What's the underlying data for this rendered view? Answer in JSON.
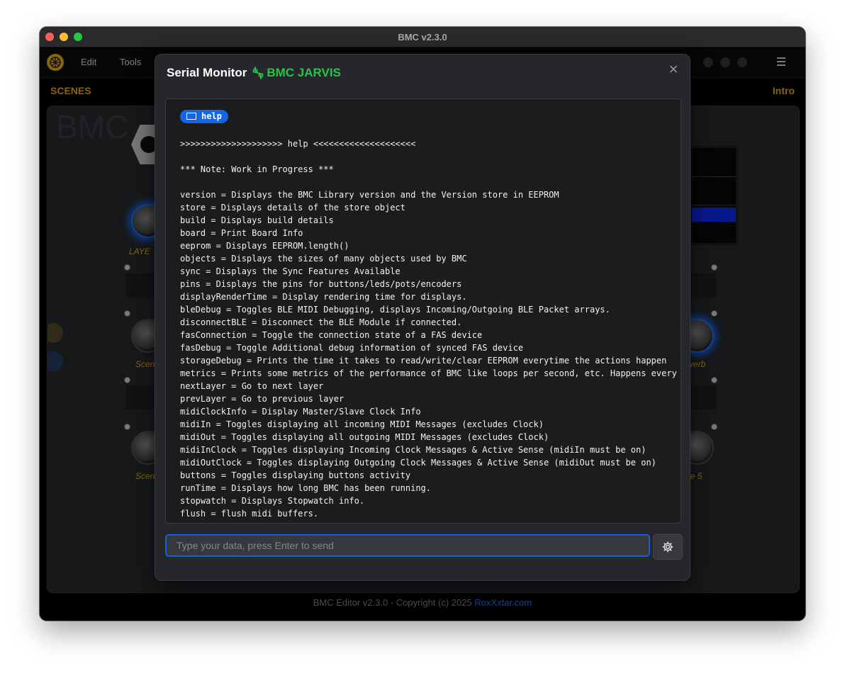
{
  "window": {
    "title": "BMC v2.3.0"
  },
  "menu": {
    "edit": "Edit",
    "tools": "Tools"
  },
  "subbar": {
    "left": "SCENES",
    "right": "Intro"
  },
  "board": {
    "title": "BMC",
    "labels": [
      "LAYE",
      "Scen",
      "Scen",
      "verb",
      "ne 5"
    ]
  },
  "footer": {
    "text": "BMC Editor v2.3.0 - Copyright (c) 2025 ",
    "link": "RoxXxtar.com"
  },
  "modal": {
    "title": "Serial Monitor",
    "device": "BMC JARVIS",
    "badge": "help",
    "lines": [
      ">>>>>>>>>>>>>>>>>>>> help <<<<<<<<<<<<<<<<<<<<",
      "",
      "*** Note: Work in Progress ***",
      "",
      "version = Displays the BMC Library version and the Version store in EEPROM",
      "store = Displays details of the store object",
      "build = Displays build details",
      "board = Print Board Info",
      "eeprom = Displays EEPROM.length()",
      "objects = Displays the sizes of many objects used by BMC",
      "sync = Displays the Sync Features Available",
      "pins = Displays the pins for buttons/leds/pots/encoders",
      "displayRenderTime = Display rendering time for displays.",
      "bleDebug = Toggles BLE MIDI Debugging, displays Incoming/Outgoing BLE Packet arrays.",
      "disconnectBLE = Disconnect the BLE Module if connected.",
      "fasConnection = Toggle the connection state of a FAS device",
      "fasDebug = Toggle Additional debug information of synced FAS device",
      "storageDebug = Prints the time it takes to read/write/clear EEPROM everytime the actions happen",
      "metrics = Prints some metrics of the performance of BMC like loops per second, etc. Happens every",
      "nextLayer = Go to next layer",
      "prevLayer = Go to previous layer",
      "midiClockInfo = Display Master/Slave Clock Info",
      "midiIn = Toggles displaying all incoming MIDI Messages (excludes Clock)",
      "midiOut = Toggles displaying all outgoing MIDI Messages (excludes Clock)",
      "midiInClock = Toggles displaying Incoming Clock Messages & Active Sense (midiIn must be on)",
      "midiOutClock = Toggles displaying Outgoing Clock Messages & Active Sense (midiOut must be on)",
      "buttons = Toggles displaying buttons activity",
      "runTime = Displays how long BMC has been running.",
      "stopwatch = Displays Stopwatch info.",
      "flush = flush midi buffers."
    ],
    "input_placeholder": "Type your data, press Enter to send",
    "input_value": ""
  },
  "colors": {
    "accent": "#f5b81c",
    "jarvis": "#27c34a",
    "badge": "#1565e6",
    "link": "#2f80ff"
  },
  "icons": [
    "logo-icon",
    "hamburger-icon",
    "close-icon",
    "usb-plug-icon",
    "keyboard-icon",
    "gear-icon"
  ]
}
